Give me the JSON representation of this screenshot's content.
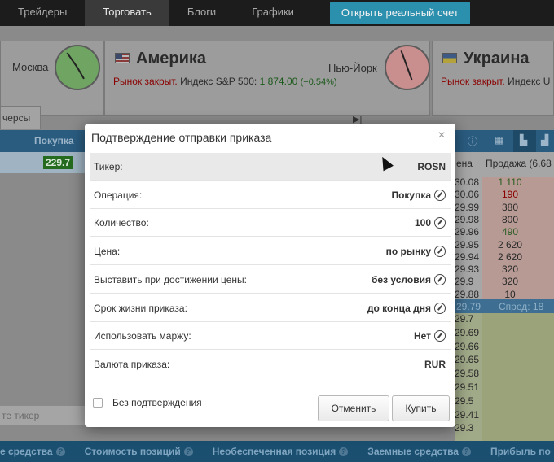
{
  "topnav": {
    "items": [
      "Трейдеры",
      "Торговать",
      "Блоги",
      "Графики"
    ],
    "active_index": 1,
    "cta": "Открыть реальный счет"
  },
  "markets": {
    "moscow_city": "Москва",
    "america": {
      "title": "Америка",
      "status": "Рынок закрыт.",
      "index_label": "Индекс S&P 500:",
      "index_value": "1 874.00",
      "index_change": "(+0.54%)",
      "city": "Нью-Йорк"
    },
    "ukraine": {
      "title": "Украина",
      "status": "Рынок закрыт.",
      "index_label": "Индекс U"
    }
  },
  "bg": {
    "tab_label": "черсы",
    "col_buy": "Покупка",
    "buy_price": "229.7",
    "col_price": "ена",
    "col_sell": "Продажа (6.68",
    "ticker_placeholder": "те тикер",
    "orderbook": [
      {
        "price": "30.08",
        "qty": "1 110"
      },
      {
        "price": "30.06",
        "qty": "190"
      },
      {
        "price": "29.99",
        "qty": "380"
      },
      {
        "price": "29.98",
        "qty": "800"
      },
      {
        "price": "29.96",
        "qty": "490"
      },
      {
        "price": "29.95",
        "qty": "2 620"
      },
      {
        "price": "29.94",
        "qty": "2 620"
      },
      {
        "price": "29.93",
        "qty": "320"
      },
      {
        "price": "29.9",
        "qty": "320"
      },
      {
        "price": "29.88",
        "qty": "10"
      }
    ],
    "spread_price": "29.79",
    "spread_label": "Спред: 18",
    "bids": [
      "29.7",
      "29.69",
      "29.66",
      "29.65",
      "29.58",
      "29.51",
      "29.5",
      "29.41",
      "29.3"
    ]
  },
  "footer": {
    "items": [
      "е средства",
      "Стоимость позиций",
      "Необеспеченная позиция",
      "Заемные средства",
      "Прибыль по"
    ]
  },
  "dialog": {
    "title": "Подтверждение отправки приказа",
    "rows": [
      {
        "label": "Тикер:",
        "value": "ROSN"
      },
      {
        "label": "Операция:",
        "value": "Покупка"
      },
      {
        "label": "Количество:",
        "value": "100"
      },
      {
        "label": "Цена:",
        "value": "по рынку"
      },
      {
        "label": "Выставить при достижении цены:",
        "value": "без условия"
      },
      {
        "label": "Срок жизни приказа:",
        "value": "до конца дня"
      },
      {
        "label": "Использовать маржу:",
        "value": "Нет"
      },
      {
        "label": "Валюта приказа:",
        "value": "RUR"
      }
    ],
    "no_confirm_label": "Без подтверждения",
    "cancel": "Отменить",
    "buy": "Купить"
  }
}
